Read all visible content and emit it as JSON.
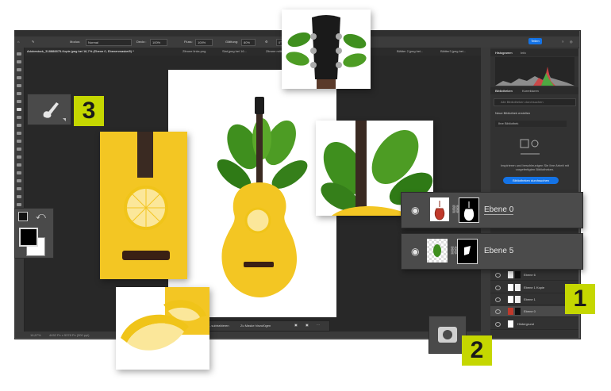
{
  "options_bar": {
    "mode_label": "Modus:",
    "mode_value": "Normal",
    "opacity_label": "Deckr.:",
    "opacity_value": "100%",
    "flow_label": "Fluss:",
    "flow_value": "100%",
    "smoothing_label": "Glättung:",
    "smoothing_value": "80%",
    "angle_value": "0°",
    "share_label": "Teilen"
  },
  "tabs": [
    "Adobestock_318888875-Kopie.jpeg bei 16,7% (Ebene 0, Ebenenmaske/8) *",
    "Zitrone links.png",
    "Slat.jpeg bei 16...",
    "Zitrone mitte.png",
    "...jpeg bei 16...",
    "Blätter 2.jpeg bei...",
    "Blätter3.jpeg bei..."
  ],
  "status": {
    "zoom": "16,67%",
    "dimensions": "4452 Px x 5378 Px (300 ppi)"
  },
  "mask_toolbar": {
    "left_label": "...subtrahieren",
    "add_mask_label": "Zu Maske hinzufügen"
  },
  "panels": {
    "histogram_tab": "Histogramm",
    "info_tab": "Info",
    "libraries_tab": "Bibliotheken",
    "corrections_tab": "Korrekturen",
    "library_search_placeholder": "Alle Bibliotheken durchsuchen",
    "new_library": "Neue Bibliothek erstellen",
    "my_library": "Ihre Bibliothek",
    "empty_text": "Inspirieren und beschleunigen Sie Ihre Arbeit mit vorgefertigten Bibliotheken.",
    "browse_button": "Bibliotheken durchsuchen"
  },
  "layers": [
    {
      "name": "Ebene 6"
    },
    {
      "name": "Ebene 1 Kopie"
    },
    {
      "name": "Ebene 1"
    },
    {
      "name": "Ebene 0"
    },
    {
      "name": "Hintergrund"
    }
  ],
  "big_layers": [
    {
      "name": "Ebene 0"
    },
    {
      "name": "Ebene 5"
    }
  ],
  "badges": {
    "one": "1",
    "two": "2",
    "three": "3"
  },
  "colors": {
    "badge": "#c5d700",
    "accent": "#1473e6",
    "lemon": "#f3c623",
    "leaf": "#3f8f1e"
  },
  "icons": {
    "brush": "brush-icon",
    "mask": "layer-mask-icon",
    "eye": "eye-icon",
    "swap": "swap-colors-icon"
  }
}
